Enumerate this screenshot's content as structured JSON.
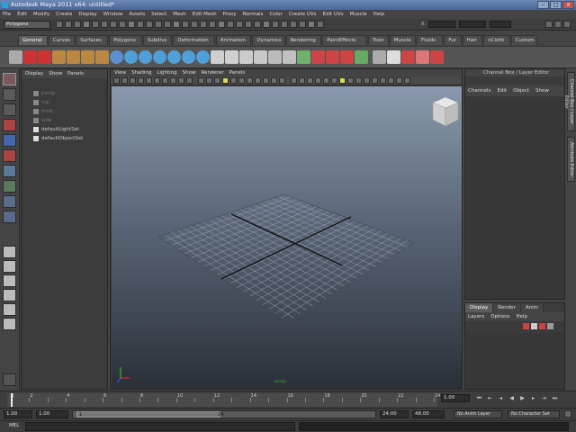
{
  "window": {
    "title": "Autodesk Maya 2011 x64: untitled*"
  },
  "menubar": [
    "File",
    "Edit",
    "Modify",
    "Create",
    "Display",
    "Window",
    "Assets",
    "Select",
    "Mesh",
    "Edit Mesh",
    "Proxy",
    "Normals",
    "Color",
    "Create UVs",
    "Edit UVs",
    "Muscle",
    "Help"
  ],
  "statusline": {
    "mode": "Polygons",
    "x_label": "X:"
  },
  "shelf": {
    "tabs": [
      "General",
      "Curves",
      "Surfaces",
      "Polygons",
      "Subdivs",
      "Deformation",
      "Animation",
      "Dynamics",
      "Rendering",
      "PaintEffects",
      "Toon",
      "Muscle",
      "Fluids",
      "Fur",
      "Hair",
      "nCloth",
      "Custom"
    ],
    "active_tab": "General"
  },
  "outliner": {
    "menu": [
      "Display",
      "Show",
      "Panels"
    ],
    "items": [
      {
        "label": "persp",
        "dim": true
      },
      {
        "label": "top",
        "dim": true
      },
      {
        "label": "front",
        "dim": true
      },
      {
        "label": "side",
        "dim": true
      },
      {
        "label": "defaultLightSet",
        "dim": false
      },
      {
        "label": "defaultObjectSet",
        "dim": false
      }
    ]
  },
  "viewport": {
    "menu": [
      "View",
      "Shading",
      "Lighting",
      "Show",
      "Renderer",
      "Panels"
    ],
    "camera": "persp"
  },
  "channelbox": {
    "title": "Channel Box / Layer Editor",
    "menu": [
      "Channels",
      "Edit",
      "Object",
      "Show"
    ]
  },
  "layereditor": {
    "tabs": [
      "Display",
      "Render",
      "Anim"
    ],
    "active_tab": "Display",
    "menu": [
      "Layers",
      "Options",
      "Help"
    ]
  },
  "sidetabs": [
    "Channel Box / Layer Editor",
    "Attribute Editor"
  ],
  "timeslider": {
    "labels": [
      "1",
      "2",
      "4",
      "6",
      "8",
      "10",
      "12",
      "14",
      "16",
      "18",
      "20",
      "22",
      "24"
    ],
    "current": "1.00"
  },
  "rangeslider": {
    "start": "1.00",
    "start2": "1.00",
    "range_start": "1",
    "range_end": "24",
    "end": "24.00",
    "end2": "48.00",
    "anim_layer": "No Anim Layer",
    "character": "No Character Set"
  },
  "cmdline": {
    "label": "MEL"
  },
  "colors": {
    "titlebar": "#5a78a6",
    "viewport_top": "#8a99ad",
    "viewport_bottom": "#2b3037",
    "grid": "#9aa3ad"
  }
}
